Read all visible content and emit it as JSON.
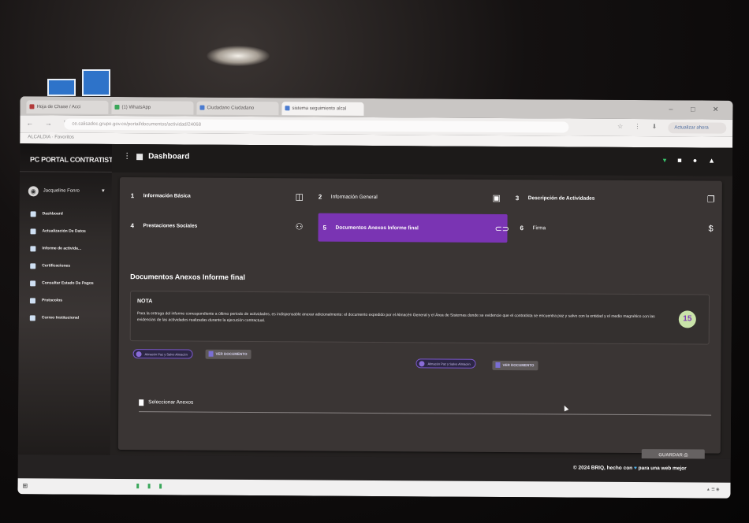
{
  "browser": {
    "tabs": [
      "Hoja de Chase / Acci",
      "(1) WhatsApp",
      "Ciudadano Ciudadano",
      "sistema seguimiento alcal"
    ],
    "url": "ce.calisadoc.grupo.gov.co/portal/documentos/actividad/24068",
    "profile": "Actualizar ahora",
    "bookmarks": "ALCALDIA  ·  Favoritos"
  },
  "sidebar": {
    "brand": "PC  PORTAL CONTRATISTA",
    "user": "Jacqueline Fonro",
    "items": [
      {
        "label": "Dashboard",
        "icon": "dashboard-icon"
      },
      {
        "label": "Actualización De Datos",
        "icon": "user-icon"
      },
      {
        "label": "Informe de activida...",
        "icon": "document-icon"
      },
      {
        "label": "Certificaciones",
        "icon": "certificate-icon"
      },
      {
        "label": "Consultar Estado De Pagos",
        "icon": "payment-icon"
      },
      {
        "label": "Protocolos",
        "icon": "protocol-icon"
      },
      {
        "label": "Correo Institucional",
        "icon": "mail-icon"
      }
    ]
  },
  "topbar": {
    "title": "Dashboard"
  },
  "steps": [
    {
      "num": "1",
      "label": "Información Básica",
      "icon": "info-icon"
    },
    {
      "num": "2",
      "label": "Información General",
      "icon": "folder-icon"
    },
    {
      "num": "3",
      "label": "Descripción de Actividades",
      "icon": "copy-icon"
    },
    {
      "num": "4",
      "label": "Prestaciones Sociales",
      "icon": "people-icon"
    },
    {
      "num": "5",
      "label": "Documentos Anexos Informe final",
      "icon": "link-icon"
    },
    {
      "num": "6",
      "label": "Firma",
      "icon": "signature-icon"
    }
  ],
  "section_title": "Documentos Anexos Informe final",
  "note": {
    "title": "NOTA",
    "text": "Para la entrega del informe correspondiente a último periodo de actividades, es indispensable anexar adicionalmente: el documento expedido por el Almacén General y el Área de Sistemas donde se evidencie que el contratista se encuentra paz y salvo con la entidad y el medio magnético con las evidencias de las actividades realizadas durante la ejecución contractual.",
    "badge": "15"
  },
  "uploads": {
    "chip1": "Almacén Paz y Salvo Almacén",
    "chip2": "Almacén Paz y Salvo Almacén",
    "view_button": "VER DOCUMENTO"
  },
  "file_field": {
    "label": "Seleccionar Anexos"
  },
  "save_button": "GUARDAR",
  "footer": {
    "copyright": "© 2024 BRIQ, hecho con",
    "suffix": "para una web mejor"
  }
}
